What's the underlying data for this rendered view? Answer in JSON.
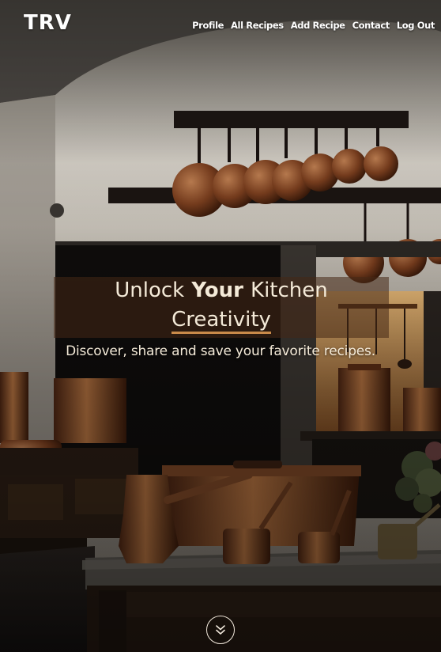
{
  "brand": {
    "logo": "TRV"
  },
  "nav": {
    "items": [
      "Profile",
      "All Recipes",
      "Add Recipe",
      "Contact",
      "Log Out"
    ]
  },
  "hero": {
    "title_part1": "Unlock",
    "title_part2": "Your",
    "title_part3": "Kitchen",
    "title_part4": "Creativity",
    "subtitle": "Discover, share and save your favorite recipes.",
    "scroll_icon": "double-chevron-down-icon"
  },
  "colors": {
    "accent": "#c98a4a",
    "text": "#f4ead8",
    "band": "#46281a"
  }
}
